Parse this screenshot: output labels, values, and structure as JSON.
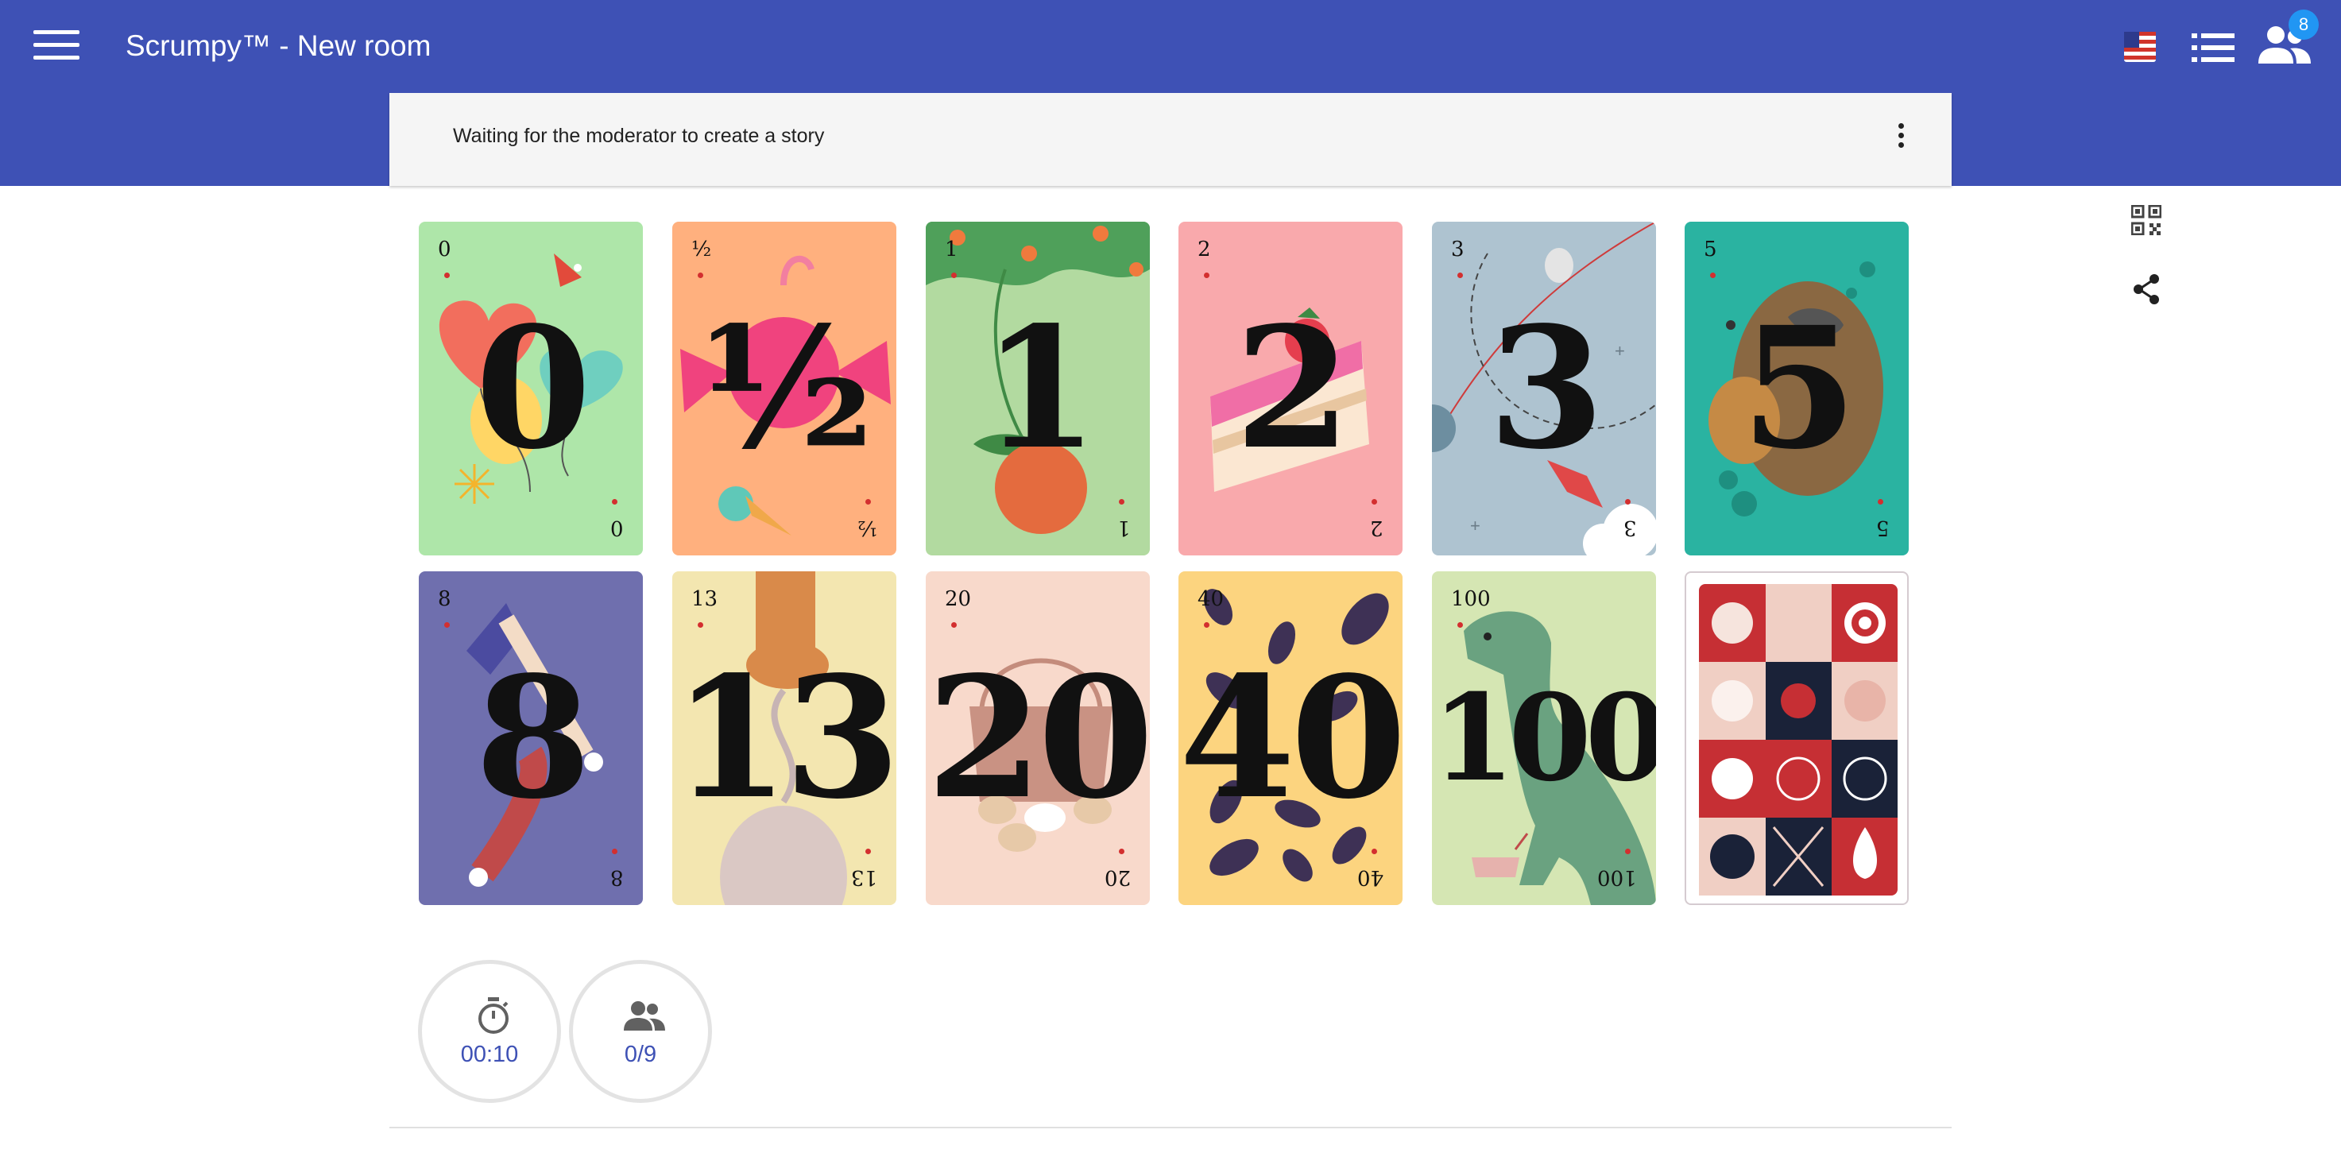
{
  "header": {
    "title": "Scrumpy™ - New room",
    "participant_badge": "8",
    "icons": [
      "menu-icon",
      "us-flag-icon",
      "story-list-icon",
      "participants-icon"
    ]
  },
  "story": {
    "status_text": "Waiting for the moderator to create a story",
    "menu_icon": "more-vertical-icon"
  },
  "side_actions": [
    "qr-code-icon",
    "share-icon"
  ],
  "cards": [
    {
      "value": "0",
      "color": "#aee6a9"
    },
    {
      "value": "½",
      "color": "#ffb07e"
    },
    {
      "value": "1",
      "color": "#b2daa0"
    },
    {
      "value": "2",
      "color": "#f9a9ac"
    },
    {
      "value": "3",
      "color": "#aec3d0"
    },
    {
      "value": "5",
      "color": "#2ab3a1"
    },
    {
      "value": "8",
      "color": "#6f6fae"
    },
    {
      "value": "13",
      "color": "#f3e6b0"
    },
    {
      "value": "20",
      "color": "#f8d9cb"
    },
    {
      "value": "40",
      "color": "#fcd47f"
    },
    {
      "value": "100",
      "color": "#d5e6b3"
    }
  ],
  "stats": {
    "timer": "00:10",
    "votes": "0/9"
  },
  "colors": {
    "primary": "#3e51b5",
    "badge": "#2196f3",
    "accent_red": "#c62f34"
  }
}
